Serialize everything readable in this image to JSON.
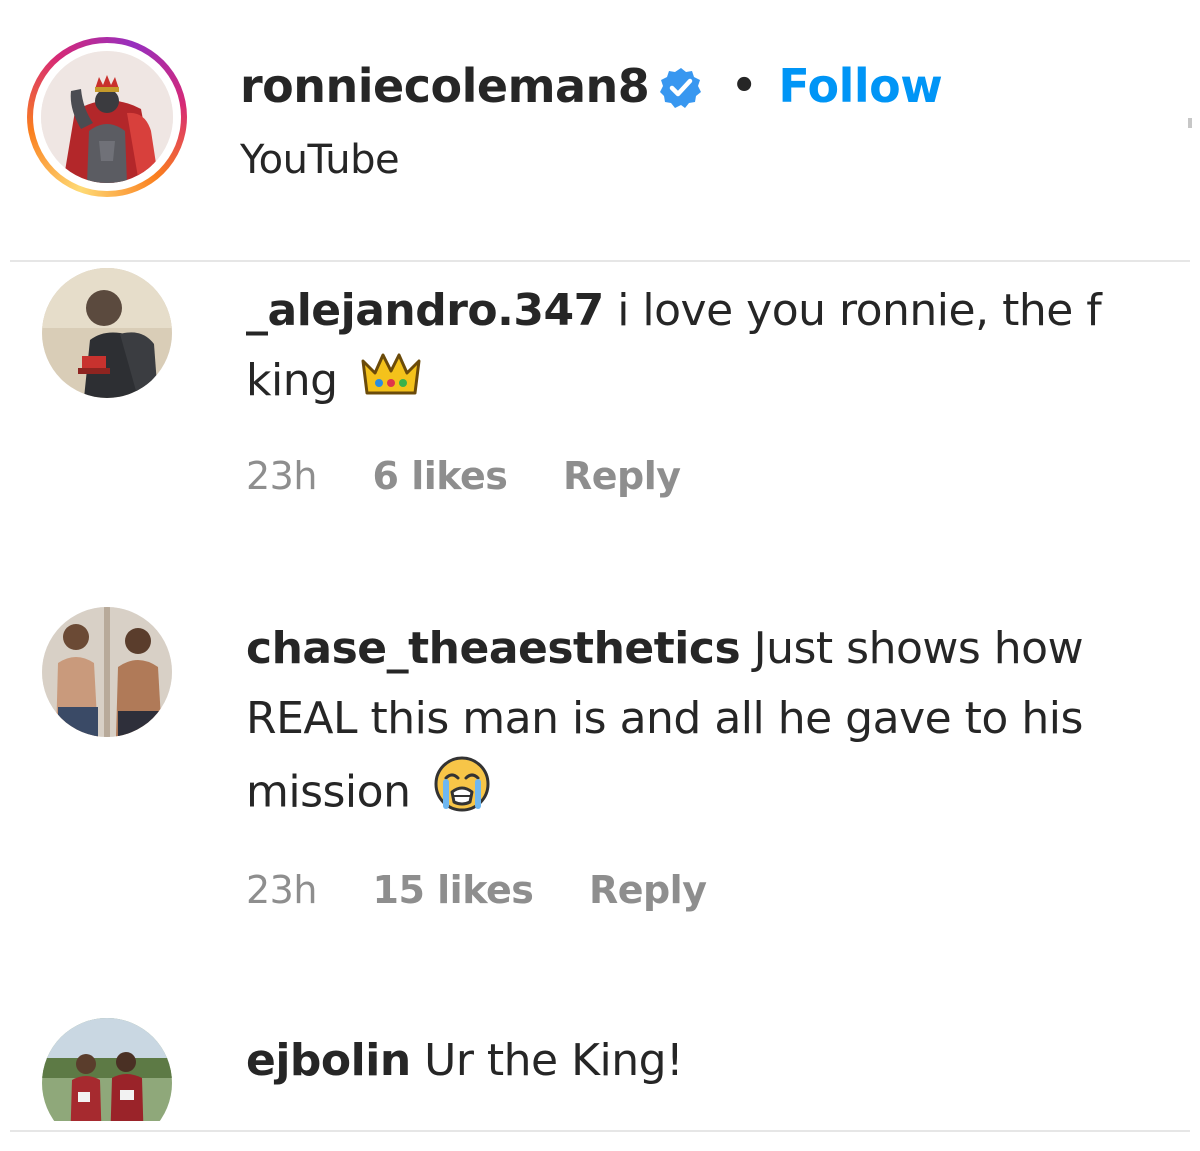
{
  "post_header": {
    "username": "ronniecoleman8",
    "verified_icon": "verified-badge-icon",
    "separator": "•",
    "follow_label": "Follow",
    "subtitle": "YouTube"
  },
  "comments": [
    {
      "username": "_alejandro.347",
      "text": "i love you ronnie, the f king",
      "emoji_icon": "crown-emoji",
      "time": "23h",
      "likes": "6 likes",
      "reply_label": "Reply"
    },
    {
      "username": "chase_theaesthetics",
      "text": "Just shows how REAL this man is and all he gave to his mission",
      "emoji_icon": "loudly-crying-face-emoji",
      "time": "23h",
      "likes": "15 likes",
      "reply_label": "Reply"
    },
    {
      "username": "ejbolin",
      "text": "Ur the King!"
    }
  ],
  "colors": {
    "text": "#262626",
    "follow_blue": "#0095f6",
    "meta_gray": "#8e8e8e",
    "divider": "#e6e6e6"
  }
}
